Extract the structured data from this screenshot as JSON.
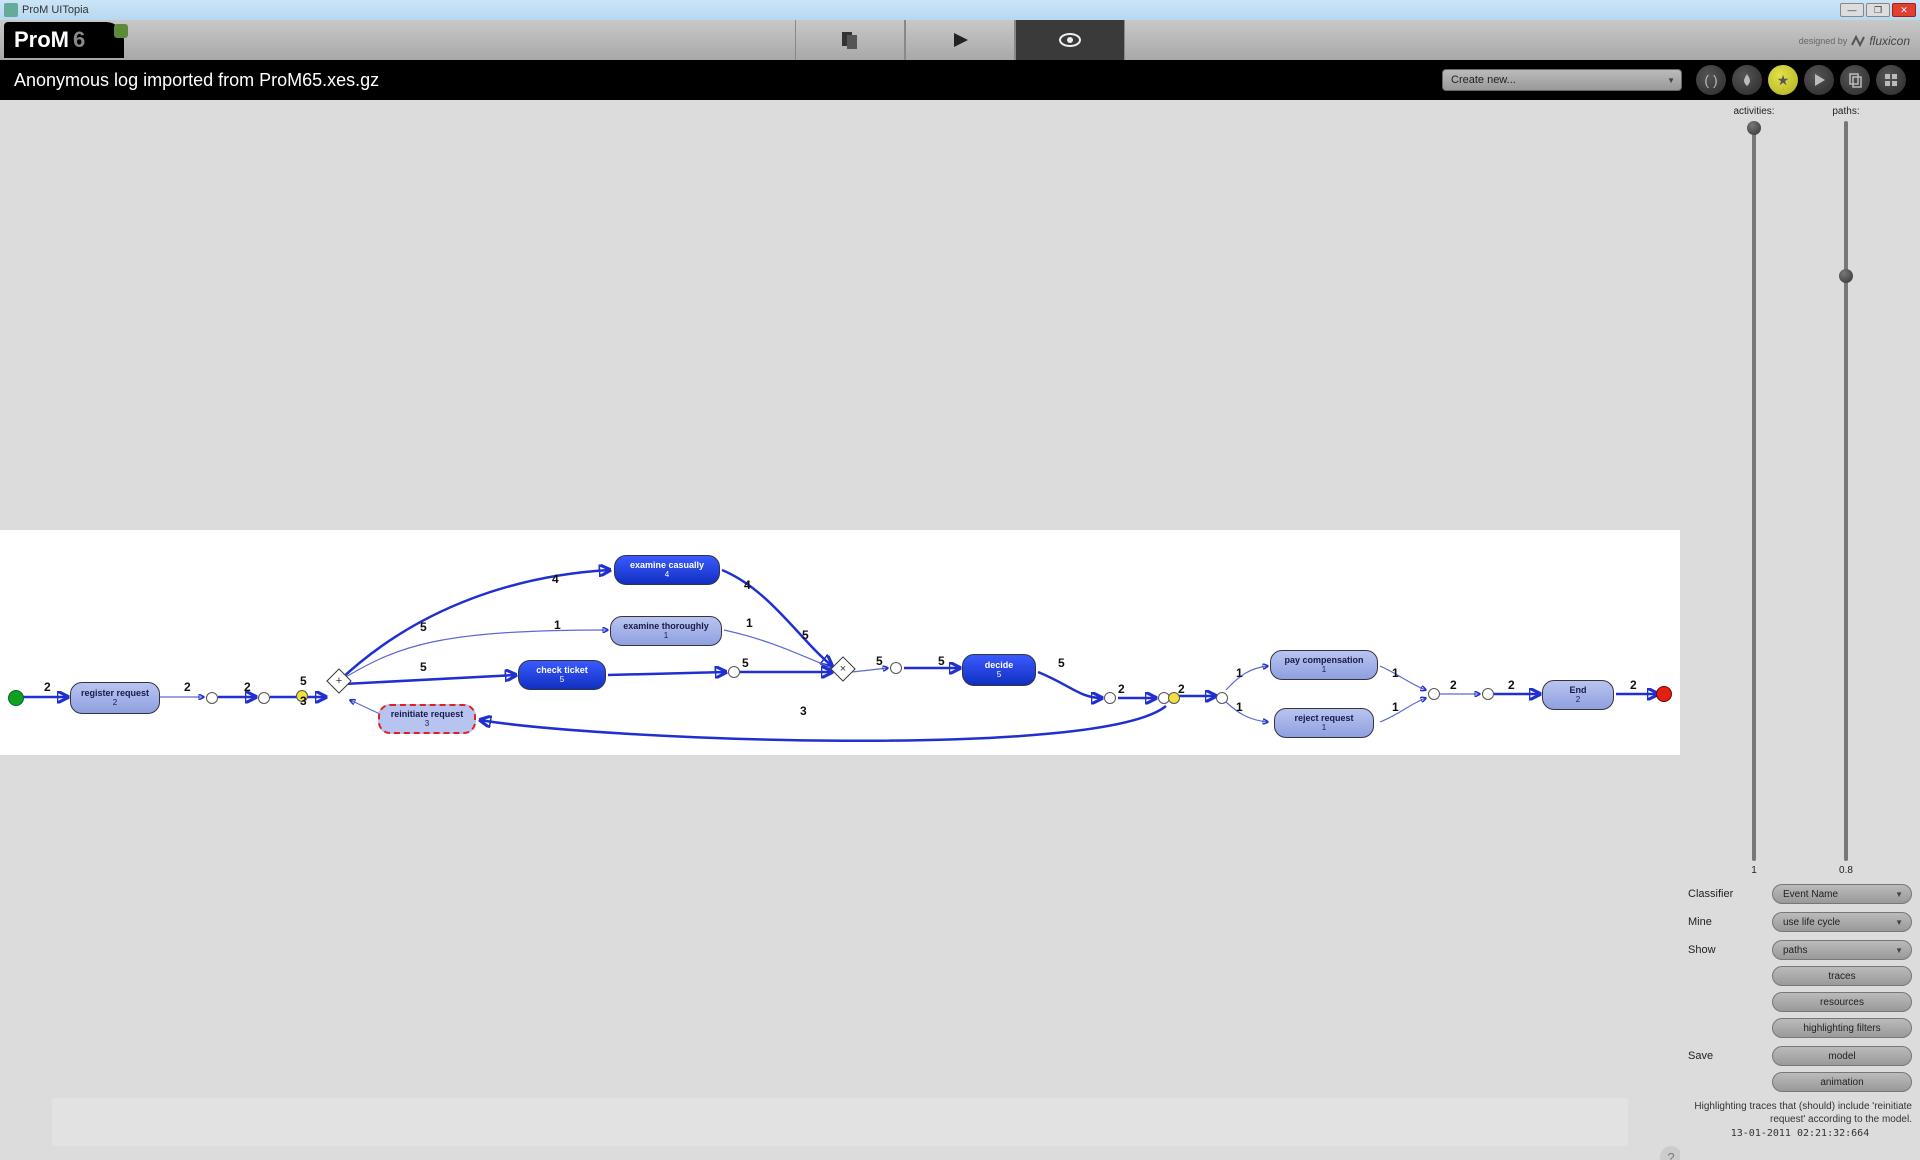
{
  "window": {
    "title": "ProM UITopia"
  },
  "logo": {
    "name": "ProM",
    "ver": "6"
  },
  "designed_by": {
    "label": "designed by",
    "brand": "fluxicon"
  },
  "subheader": {
    "title": "Anonymous log imported from ProM65.xes.gz",
    "create": "Create new..."
  },
  "panel": {
    "activities": {
      "label": "activities:",
      "value": "1",
      "thumbPct": 0
    },
    "paths": {
      "label": "paths:",
      "value": "0.8",
      "thumbPct": 20
    },
    "classifier": {
      "label": "Classifier",
      "value": "Event Name"
    },
    "mine": {
      "label": "Mine",
      "value": "use life cycle"
    },
    "show": {
      "label": "Show",
      "value": "paths"
    },
    "buttons": {
      "traces": "traces",
      "resources": "resources",
      "filters": "highlighting filters",
      "model": "model",
      "animation": "animation"
    },
    "save_label": "Save",
    "status": "Highlighting traces that (should) include 'reinitiate request' according to the model.",
    "timestamp": "13-01-2011 02:21:32:664"
  },
  "nodes": {
    "register": {
      "name": "register request",
      "count": "2"
    },
    "reinit": {
      "name": "reinitiate request",
      "count": "3"
    },
    "excas": {
      "name": "examine casually",
      "count": "4"
    },
    "exthor": {
      "name": "examine thoroughly",
      "count": "1"
    },
    "check": {
      "name": "check ticket",
      "count": "5"
    },
    "decide": {
      "name": "decide",
      "count": "5"
    },
    "paycomp": {
      "name": "pay compensation",
      "count": "1"
    },
    "reject": {
      "name": "reject request",
      "count": "1"
    },
    "end": {
      "name": "End",
      "count": "2"
    }
  },
  "edges": {
    "e1": "2",
    "e2": "2",
    "e3": "2",
    "e4": "5",
    "e5": "5",
    "e6": "4",
    "e7": "1",
    "e8": "5",
    "e9": "4",
    "e10": "1",
    "e11": "5",
    "e12": "5",
    "e13": "5",
    "e14": "5",
    "e15": "2",
    "e16": "2",
    "e17": "1",
    "e18": "1",
    "e19": "1",
    "e20": "1",
    "e21": "2",
    "e22": "2",
    "e23": "2",
    "e24": "3",
    "e25": "3"
  }
}
